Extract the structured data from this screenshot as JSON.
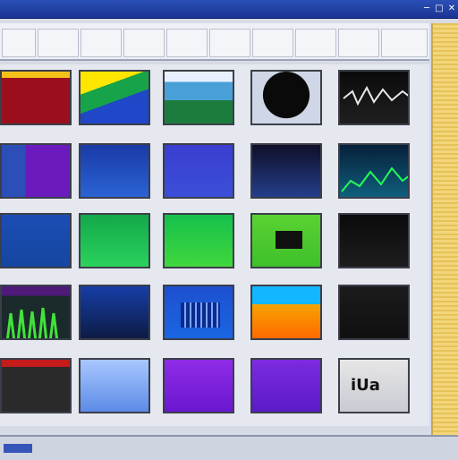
{
  "window": {
    "title": "",
    "controls": [
      "minimize",
      "maximize",
      "close"
    ]
  },
  "toolbar": {
    "cells": 11
  },
  "tiles": [
    {
      "caption": "",
      "overlay": ""
    },
    {
      "caption": "",
      "overlay": ""
    },
    {
      "caption": "",
      "overlay": ""
    },
    {
      "caption": "",
      "overlay": ""
    },
    {
      "caption": "",
      "overlay": ""
    },
    {
      "caption": "",
      "overlay": ""
    },
    {
      "caption": "",
      "overlay": ""
    },
    {
      "caption": "",
      "overlay": ""
    },
    {
      "caption": "",
      "overlay": ""
    },
    {
      "caption": "",
      "overlay": ""
    },
    {
      "caption": "",
      "overlay": ""
    },
    {
      "caption": "",
      "overlay": ""
    },
    {
      "caption": "",
      "overlay": ""
    },
    {
      "caption": "",
      "overlay": ""
    },
    {
      "caption": "",
      "overlay": ""
    },
    {
      "caption": "",
      "overlay": ""
    },
    {
      "caption": "",
      "overlay": ""
    },
    {
      "caption": "",
      "overlay": ""
    },
    {
      "caption": "",
      "overlay": ""
    },
    {
      "caption": "",
      "overlay": ""
    },
    {
      "caption": "",
      "overlay": ""
    },
    {
      "caption": "",
      "overlay": ""
    },
    {
      "caption": "",
      "overlay": ""
    },
    {
      "caption": "",
      "overlay": ""
    },
    {
      "caption": "",
      "overlay": "iUa"
    }
  ],
  "status": {
    "text": ""
  }
}
